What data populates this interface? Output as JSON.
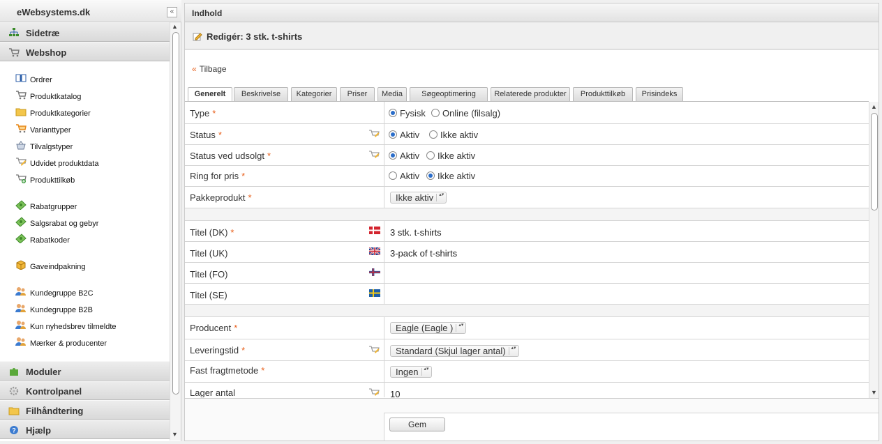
{
  "sidebar": {
    "title": "eWebsystems.dk",
    "collapse": "«",
    "sections": {
      "sitetree": "Sidetræ",
      "webshop": "Webshop",
      "modules": "Moduler",
      "controlpanel": "Kontrolpanel",
      "files": "Filhåndtering",
      "help": "Hjælp"
    },
    "items": [
      {
        "label": "Ordrer",
        "icon": "book-icon"
      },
      {
        "label": "Produktkatalog",
        "icon": "cart-icon"
      },
      {
        "label": "Produktkategorier",
        "icon": "folder-icon"
      },
      {
        "label": "Varianttyper",
        "icon": "cart-orange-icon"
      },
      {
        "label": "Tilvalgstyper",
        "icon": "basket-icon"
      },
      {
        "label": "Udvidet produktdata",
        "icon": "cart-edit-icon"
      },
      {
        "label": "Produkttilkøb",
        "icon": "cart-add-icon"
      },
      {
        "label": "Rabatgrupper",
        "icon": "money-icon"
      },
      {
        "label": "Salgsrabat og gebyr",
        "icon": "money-icon"
      },
      {
        "label": "Rabatkoder",
        "icon": "money-icon"
      },
      {
        "label": "Gaveindpakning",
        "icon": "package-icon"
      },
      {
        "label": "Kundegruppe B2C",
        "icon": "group-icon"
      },
      {
        "label": "Kundegruppe B2B",
        "icon": "group-icon"
      },
      {
        "label": "Kun nyhedsbrev tilmeldte",
        "icon": "group-icon"
      },
      {
        "label": "Mærker & producenter",
        "icon": "group-icon"
      }
    ]
  },
  "main": {
    "title": "Indhold",
    "edit_title": "Redigér: 3 stk. t-shirts",
    "back_arrow": "«",
    "back_label": "Tilbage",
    "tabs": [
      "Generelt",
      "Beskrivelse",
      "Kategorier",
      "Priser",
      "Media",
      "Søgeoptimering",
      "Relaterede produkter",
      "Produkttilkøb",
      "Prisindeks"
    ],
    "required_mark": "*",
    "fields": {
      "type": {
        "label": "Type",
        "options": [
          "Fysisk",
          "Online (filsalg)"
        ],
        "selected": "Fysisk"
      },
      "status": {
        "label": "Status",
        "options": [
          "Aktiv",
          "Ikke aktiv"
        ],
        "selected": "Aktiv"
      },
      "status_soldout": {
        "label": "Status ved udsolgt",
        "options": [
          "Aktiv",
          "Ikke aktiv"
        ],
        "selected": "Aktiv"
      },
      "ring": {
        "label": "Ring for pris",
        "options": [
          "Aktiv",
          "Ikke aktiv"
        ],
        "selected": "Ikke aktiv"
      },
      "package": {
        "label": "Pakkeprodukt",
        "value": "Ikke aktiv"
      },
      "title_dk": {
        "label": "Titel (DK)",
        "value": "3 stk. t-shirts",
        "flag": "denmark-flag"
      },
      "title_uk": {
        "label": "Titel (UK)",
        "value": "3-pack of t-shirts",
        "flag": "uk-flag"
      },
      "title_fo": {
        "label": "Titel (FO)",
        "value": "",
        "flag": "faroe-flag"
      },
      "title_se": {
        "label": "Titel (SE)",
        "value": "",
        "flag": "sweden-flag"
      },
      "producer": {
        "label": "Producent",
        "value": "Eagle (Eagle )"
      },
      "delivery": {
        "label": "Leveringstid",
        "value": "Standard (Skjul lager antal)"
      },
      "freight": {
        "label": "Fast fragtmetode",
        "value": "Ingen"
      },
      "stock": {
        "label": "Lager antal",
        "value": "10"
      }
    },
    "save_label": "Gem"
  },
  "colors": {
    "accent": "#e8601c",
    "radio": "#2a6dc9"
  }
}
